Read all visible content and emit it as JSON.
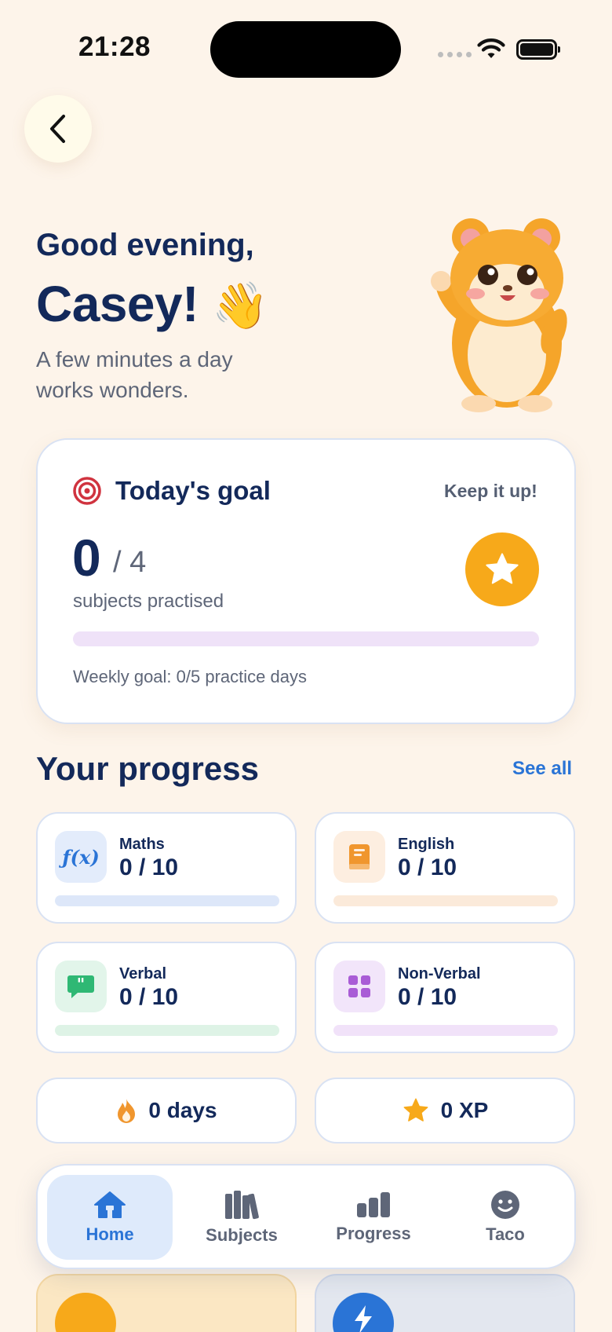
{
  "status_bar": {
    "time": "21:28"
  },
  "greeting": {
    "line1": "Good evening,",
    "name": "Casey!",
    "wave_emoji": "👋",
    "subtitle": "A few minutes a day works wonders."
  },
  "goal": {
    "title": "Today's goal",
    "encouragement": "Keep it up!",
    "done": "0",
    "total": "/ 4",
    "caption": "subjects practised",
    "progress_fraction": 0,
    "weekly": "Weekly goal: 0/5 practice days"
  },
  "progress": {
    "title": "Your progress",
    "see_all": "See all",
    "subjects": [
      {
        "name": "Maths",
        "score": "0 / 10",
        "icon": "function-icon",
        "color": "#2a74d6",
        "bg": "#e3ecfb",
        "track": "#dde7f9",
        "progress_fraction": 0
      },
      {
        "name": "English",
        "score": "0 / 10",
        "icon": "book-icon",
        "color": "#f0962e",
        "bg": "#fdeee0",
        "track": "#fbeada",
        "progress_fraction": 0
      },
      {
        "name": "Verbal",
        "score": "0 / 10",
        "icon": "speech-bubble-icon",
        "color": "#2fb874",
        "bg": "#e2f5ea",
        "track": "#def3e6",
        "progress_fraction": 0
      },
      {
        "name": "Non-Verbal",
        "score": "0 / 10",
        "icon": "grid-icon",
        "color": "#a95cd6",
        "bg": "#f2e5fa",
        "track": "#f1e2f9",
        "progress_fraction": 0
      }
    ]
  },
  "stats": {
    "streak": "0 days",
    "xp": "0 XP"
  },
  "tabs": [
    {
      "label": "Home",
      "icon": "home-icon",
      "active": true
    },
    {
      "label": "Subjects",
      "icon": "books-icon",
      "active": false
    },
    {
      "label": "Progress",
      "icon": "bar-chart-icon",
      "active": false
    },
    {
      "label": "Taco",
      "icon": "smiley-icon",
      "active": false
    }
  ],
  "colors": {
    "background": "#fdf4ea",
    "navy": "#13295a",
    "accent_blue": "#2a74d6",
    "star_orange": "#f7a91a"
  }
}
